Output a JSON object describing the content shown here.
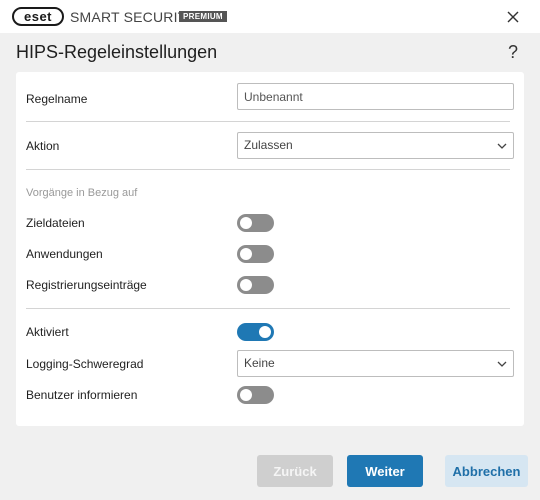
{
  "titlebar": {
    "logo_text": "eset",
    "product_name": "SMART SECURITY",
    "edition": "PREMIUM",
    "close_icon": "close-icon"
  },
  "header": {
    "title": "HIPS-Regeleinstellungen",
    "help_label": "?"
  },
  "form": {
    "rule_name": {
      "label": "Regelname",
      "value": "Unbenannt"
    },
    "action": {
      "label": "Aktion",
      "selected": "Zulassen"
    },
    "section_caption": "Vorgänge in Bezug auf",
    "target_files": {
      "label": "Zieldateien",
      "enabled": false
    },
    "applications": {
      "label": "Anwendungen",
      "enabled": false
    },
    "registry_entries": {
      "label": "Registrierungseinträge",
      "enabled": false
    },
    "enabled": {
      "label": "Aktiviert",
      "enabled": true
    },
    "logging_severity": {
      "label": "Logging-Schweregrad",
      "selected": "Keine"
    },
    "notify_user": {
      "label": "Benutzer informieren",
      "enabled": false
    }
  },
  "footer": {
    "back_label": "Zurück",
    "next_label": "Weiter",
    "cancel_label": "Abbrechen"
  },
  "colors": {
    "accent": "#1f78b4",
    "toggle_off": "#8c8c8c",
    "disabled_button": "#cfcfcf",
    "secondary_button": "#d6e6f2"
  }
}
